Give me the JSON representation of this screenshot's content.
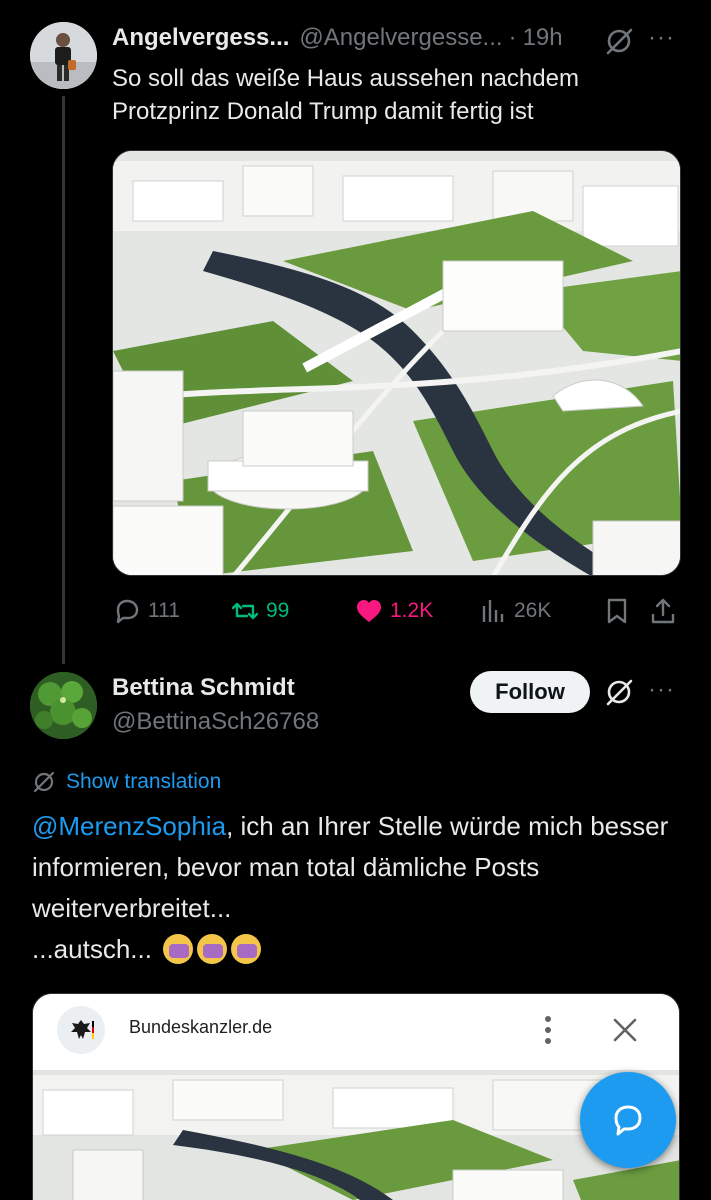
{
  "tweet1": {
    "name": "Angelvergess...",
    "handle": "@Angelvergesse...",
    "dot": "·",
    "time": "19h",
    "more": "···",
    "text": "So soll das weiße Haus aussehen nachdem Protzprinz Donald Trump damit fertig ist",
    "metrics": {
      "replies": "111",
      "retweets": "99",
      "likes": "1.2K",
      "views": "26K"
    }
  },
  "tweet2": {
    "name": "Bettina Schmidt",
    "handle": "@BettinaSch26768",
    "follow_label": "Follow",
    "more": "···",
    "translate_label": "Show translation",
    "mention": "@MerenzSophia",
    "text": ", ich an Ihrer Stelle würde mich besser informieren, bevor man total dämliche Posts weiterverbreitet...",
    "text2": "...autsch...",
    "card": {
      "domain": "Bundeskanzler.de"
    }
  },
  "colors": {
    "background": "#000000",
    "text": "#e7e9ea",
    "muted": "#71767b",
    "link": "#1d9bf0",
    "retweet": "#00ba7c",
    "like": "#f91880"
  },
  "icons": [
    "grok-icon",
    "more-icon",
    "reply-icon",
    "retweet-icon",
    "heart-icon",
    "views-icon",
    "bookmark-icon",
    "share-icon",
    "translate-icon",
    "close-icon",
    "kebab-icon",
    "compose-message-icon",
    "eagle-icon"
  ]
}
